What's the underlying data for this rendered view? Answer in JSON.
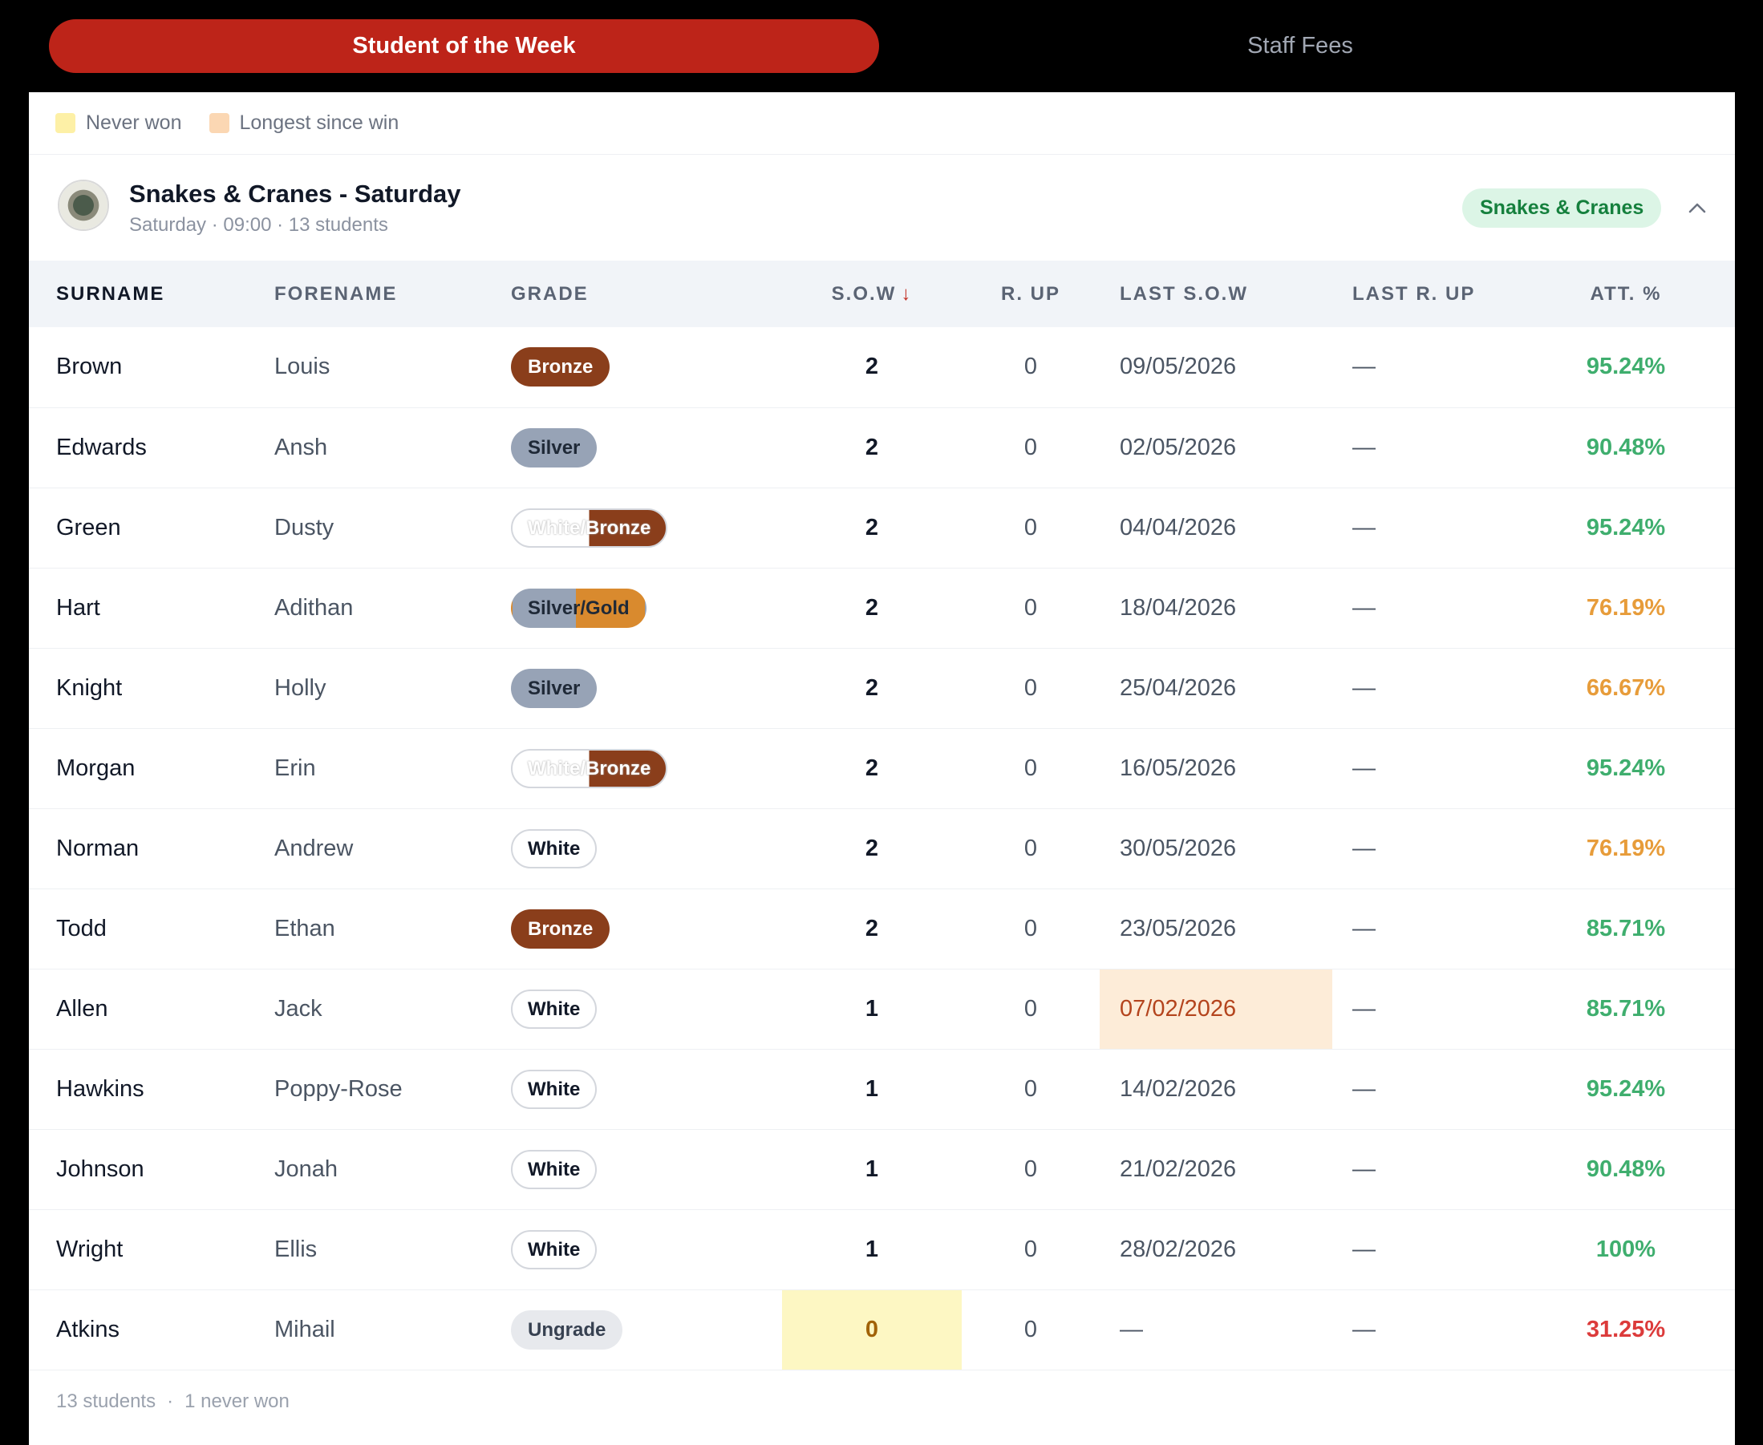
{
  "tabs": {
    "active": "Student of the Week",
    "inactive": "Staff Fees"
  },
  "legend": [
    {
      "label": "Never won",
      "color": "#fdf0a6"
    },
    {
      "label": "Longest since win",
      "color": "#fbd7b3"
    }
  ],
  "group": {
    "title": "Snakes & Cranes - Saturday",
    "subtitle": "Saturday · 09:00 · 13 students",
    "tag": "Snakes & Cranes"
  },
  "columns": {
    "surname": "SURNAME",
    "forename": "FORENAME",
    "grade": "GRADE",
    "sow": "S.O.W",
    "rup": "R. UP",
    "last_sow": "LAST S.O.W",
    "last_rup": "LAST R. UP",
    "att": "ATT. %"
  },
  "rows": [
    {
      "surname": "Brown",
      "forename": "Louis",
      "grade": "Bronze",
      "grade_style": "bronze",
      "sow": "2",
      "rup": "0",
      "last_sow": "09/05/2026",
      "last_rup": "—",
      "att": "95.24%",
      "att_color": "#3fae6e"
    },
    {
      "surname": "Edwards",
      "forename": "Ansh",
      "grade": "Silver",
      "grade_style": "silver",
      "sow": "2",
      "rup": "0",
      "last_sow": "02/05/2026",
      "last_rup": "—",
      "att": "90.48%",
      "att_color": "#3fae6e"
    },
    {
      "surname": "Green",
      "forename": "Dusty",
      "grade": "White/Bronze",
      "grade_style": "wb",
      "sow": "2",
      "rup": "0",
      "last_sow": "04/04/2026",
      "last_rup": "—",
      "att": "95.24%",
      "att_color": "#3fae6e"
    },
    {
      "surname": "Hart",
      "forename": "Adithan",
      "grade": "Silver/Gold",
      "grade_style": "sg",
      "sow": "2",
      "rup": "0",
      "last_sow": "18/04/2026",
      "last_rup": "—",
      "att": "76.19%",
      "att_color": "#e79c3a"
    },
    {
      "surname": "Knight",
      "forename": "Holly",
      "grade": "Silver",
      "grade_style": "silver",
      "sow": "2",
      "rup": "0",
      "last_sow": "25/04/2026",
      "last_rup": "—",
      "att": "66.67%",
      "att_color": "#e79c3a"
    },
    {
      "surname": "Morgan",
      "forename": "Erin",
      "grade": "White/Bronze",
      "grade_style": "wb",
      "sow": "2",
      "rup": "0",
      "last_sow": "16/05/2026",
      "last_rup": "—",
      "att": "95.24%",
      "att_color": "#3fae6e"
    },
    {
      "surname": "Norman",
      "forename": "Andrew",
      "grade": "White",
      "grade_style": "white",
      "sow": "2",
      "rup": "0",
      "last_sow": "30/05/2026",
      "last_rup": "—",
      "att": "76.19%",
      "att_color": "#e79c3a"
    },
    {
      "surname": "Todd",
      "forename": "Ethan",
      "grade": "Bronze",
      "grade_style": "bronze",
      "sow": "2",
      "rup": "0",
      "last_sow": "23/05/2026",
      "last_rup": "—",
      "att": "85.71%",
      "att_color": "#3fae6e"
    },
    {
      "surname": "Allen",
      "forename": "Jack",
      "grade": "White",
      "grade_style": "white",
      "sow": "1",
      "rup": "0",
      "last_sow": "07/02/2026",
      "last_sow_highlight": "peach",
      "last_rup": "—",
      "att": "85.71%",
      "att_color": "#3fae6e"
    },
    {
      "surname": "Hawkins",
      "forename": "Poppy-Rose",
      "grade": "White",
      "grade_style": "white",
      "sow": "1",
      "rup": "0",
      "last_sow": "14/02/2026",
      "last_rup": "—",
      "att": "95.24%",
      "att_color": "#3fae6e"
    },
    {
      "surname": "Johnson",
      "forename": "Jonah",
      "grade": "White",
      "grade_style": "white",
      "sow": "1",
      "rup": "0",
      "last_sow": "21/02/2026",
      "last_rup": "—",
      "att": "90.48%",
      "att_color": "#3fae6e"
    },
    {
      "surname": "Wright",
      "forename": "Ellis",
      "grade": "White",
      "grade_style": "white",
      "sow": "1",
      "rup": "0",
      "last_sow": "28/02/2026",
      "last_rup": "—",
      "att": "100%",
      "att_color": "#3fae6e"
    },
    {
      "surname": "Atkins",
      "forename": "Mihail",
      "grade": "Ungrade",
      "grade_style": "ungrade",
      "sow": "0",
      "sow_highlight": "yellow",
      "rup": "0",
      "last_sow": "—",
      "last_rup": "—",
      "att": "31.25%",
      "att_color": "#dc3b3b"
    }
  ],
  "footer": {
    "count": "13 students",
    "never_won": "1 never won"
  }
}
